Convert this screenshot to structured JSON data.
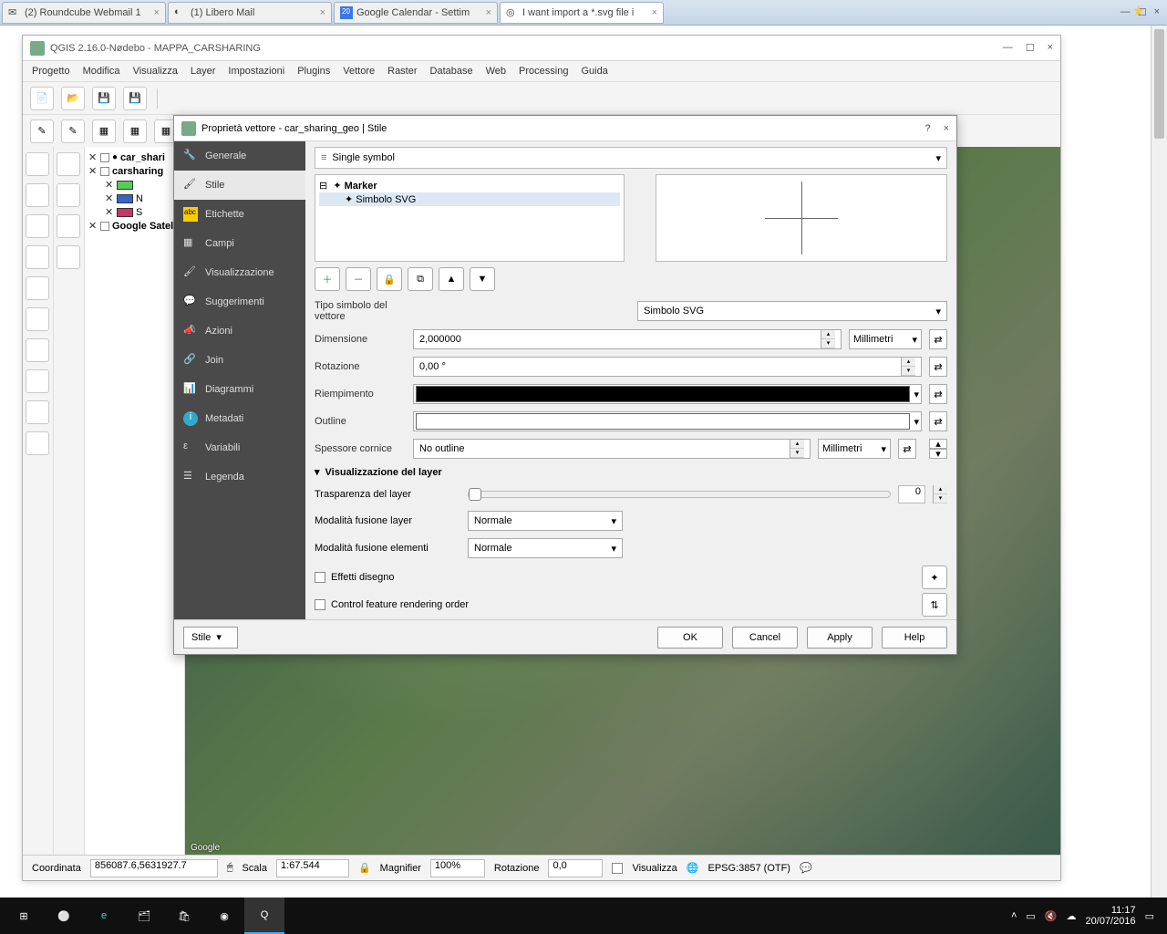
{
  "browser": {
    "tabs": [
      {
        "label": "(2) Roundcube Webmail 1"
      },
      {
        "label": "(1) Libero Mail"
      },
      {
        "label": "Google Calendar - Settim"
      },
      {
        "label": "I want import a *.svg file i"
      }
    ]
  },
  "qgis": {
    "title": "QGIS 2.16.0-Nødebo - MAPPA_CARSHARING",
    "menu": [
      "Progetto",
      "Modifica",
      "Visualizza",
      "Layer",
      "Impostazioni",
      "Plugins",
      "Vettore",
      "Raster",
      "Database",
      "Web",
      "Processing",
      "Guida"
    ],
    "layers": {
      "l0": "car_shari",
      "l1": "carsharing",
      "l2": "N",
      "l3": "S",
      "l4": "Google Satelli"
    },
    "status": {
      "coord_lbl": "Coordinata",
      "coord_val": "856087.6,5631927.7",
      "scale_lbl": "Scala",
      "scale_val": "1:67.544",
      "mag_lbl": "Magnifier",
      "mag_val": "100%",
      "rot_lbl": "Rotazione",
      "rot_val": "0,0",
      "vis_lbl": "Visualizza",
      "crs": "EPSG:3857 (OTF)"
    },
    "map_attr": "Google"
  },
  "dialog": {
    "title": "Proprietà vettore - car_sharing_geo | Stile",
    "sidebar": {
      "generale": "Generale",
      "stile": "Stile",
      "etichette": "Etichette",
      "campi": "Campi",
      "visual": "Visualizzazione",
      "sugg": "Suggerimenti",
      "azioni": "Azioni",
      "join": "Join",
      "diagrammi": "Diagrammi",
      "metadati": "Metadati",
      "variabili": "Variabili",
      "legenda": "Legenda"
    },
    "symbol_type": "Single symbol",
    "tree": {
      "marker": "Marker",
      "svg": "Simbolo SVG"
    },
    "form": {
      "tipo_lbl": "Tipo simbolo del vettore",
      "tipo_val": "Simbolo SVG",
      "dim_lbl": "Dimensione",
      "dim_val": "2,000000",
      "unit_mm": "Millimetri",
      "rot_lbl": "Rotazione",
      "rot_val": "0,00 °",
      "fill_lbl": "Riempimento",
      "outline_lbl": "Outline",
      "stroke_lbl": "Spessore cornice",
      "stroke_val": "No outline"
    },
    "layer_vis": {
      "header": "Visualizzazione del layer",
      "trans_lbl": "Trasparenza del layer",
      "trans_val": "0",
      "blend_layer_lbl": "Modalità fusione layer",
      "blend_elem_lbl": "Modalità fusione elementi",
      "blend_val": "Normale",
      "effects": "Effetti disegno",
      "order": "Control feature rendering order"
    },
    "footer": {
      "style": "Stile",
      "ok": "OK",
      "cancel": "Cancel",
      "apply": "Apply",
      "help": "Help"
    }
  },
  "taskbar": {
    "time": "11:17",
    "date": "20/07/2016"
  }
}
